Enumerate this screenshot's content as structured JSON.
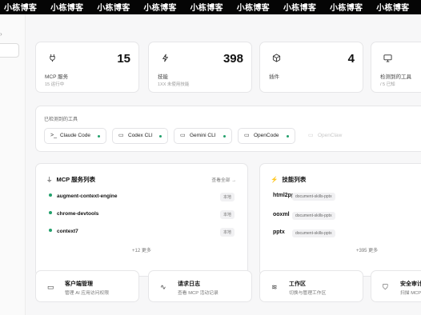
{
  "watermark": {
    "text": "小栋博客",
    "repeat": [
      1,
      2,
      3,
      4,
      5,
      6,
      7,
      8,
      9,
      10
    ]
  },
  "sidebar": {
    "collapse_icon": "chevron-icon"
  },
  "stats": [
    {
      "icon": "plug-icon",
      "value": "15",
      "label": "MCP 服务",
      "sub": "15 运行中"
    },
    {
      "icon": "sparkle-icon",
      "value": "398",
      "label": "技能",
      "sub": "1XX 未使用技能"
    },
    {
      "icon": "box-icon",
      "value": "4",
      "label": "插件",
      "sub": ""
    },
    {
      "icon": "monitor-icon",
      "value": "",
      "label": "检测到的工具",
      "sub": "/ 5 已知"
    }
  ],
  "tools": {
    "title": "已检测到的工具",
    "items": [
      {
        "icon": "terminal-icon",
        "label": "Claude Code",
        "active": true
      },
      {
        "icon": "monitor-icon",
        "label": "Codex CLI",
        "active": true
      },
      {
        "icon": "monitor-icon",
        "label": "Gemini CLI",
        "active": true
      },
      {
        "icon": "monitor-icon",
        "label": "OpenCode",
        "active": true
      },
      {
        "icon": "monitor-icon",
        "label": "OpenClaw",
        "active": false
      }
    ]
  },
  "mcp_panel": {
    "title": "MCP 服务列表",
    "view_all": "查看全部 →",
    "rows": [
      {
        "name": "augment-context-engine",
        "badge": "本地"
      },
      {
        "name": "chrome-devtools",
        "badge": "本地"
      },
      {
        "name": "context7",
        "badge": "本地"
      }
    ],
    "more": "+12 更多"
  },
  "skills_panel": {
    "title": "技能列表",
    "rows": [
      {
        "name": "html2pptx",
        "tag": "document-skills-pptx"
      },
      {
        "name": "ooxml",
        "tag": "document-skills-pptx"
      },
      {
        "name": "pptx",
        "tag": "document-skills-pptx"
      }
    ],
    "more": "+395 更多"
  },
  "nav_cards": [
    {
      "icon": "monitor-icon",
      "title": "客户端管理",
      "desc": "管理 AI 应用访问权限"
    },
    {
      "icon": "activity-icon",
      "title": "请求日志",
      "desc": "查看 MCP 活动记录"
    },
    {
      "icon": "layers-icon",
      "title": "工作区",
      "desc": "切换与管理工作区"
    },
    {
      "icon": "shield-icon",
      "title": "安全审计",
      "desc": "扫描 MCP"
    }
  ],
  "colors": {
    "active_dot": "#22a06b",
    "watermark_bg": "#050505"
  }
}
